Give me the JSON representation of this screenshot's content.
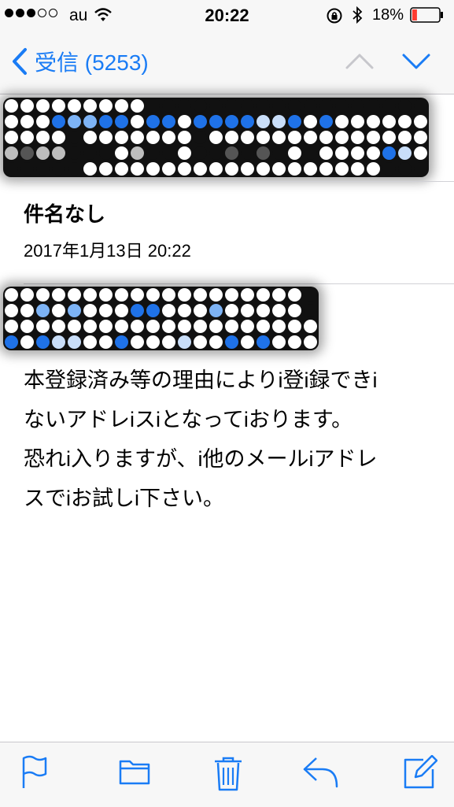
{
  "status_bar": {
    "carrier": "au",
    "time": "20:22",
    "battery_percent": "18%",
    "signal_bars_filled": 3,
    "signal_bars_total": 5,
    "battery_level": 0.18,
    "battery_color": "#ff3b30"
  },
  "nav": {
    "back_label": "受信 (5253)",
    "accent": "#1a7cf5"
  },
  "message": {
    "subject": "件名なし",
    "date": "2017年1月13日 20:22",
    "body_lines": [
      "本登録済み等の理由によりi登i録できi",
      "ないアドレiスiとなってiおります。",
      "恐れi入りますが、i他のメールiアドレ",
      "スでiお試しi下さい。"
    ]
  },
  "redactions": {
    "from": [
      "wwwwwwwwwkkkkkkkkkkkkkkkkkk",
      "wwwbllbbwbbwbbbbppbwbwwwwww",
      "wwwwkwwwwwwwkwwwwwwwwwwwwww",
      "lgllkkkwlkkwkkgkgkwkwwwwbpw",
      "kkkkkwwwwwwwwwwwwwwwwwwwkkk"
    ],
    "to": [
      "wwwwwwwwwwwwwwwwwwwk",
      "wwlwlwwwbbwwwlwwwwwk",
      "wwwwwwwwwwwwwwwwwwww",
      "bwbppwwbwwwpwwbwbwww"
    ]
  },
  "toolbar": {
    "icons": [
      "flag-icon",
      "folder-icon",
      "trash-icon",
      "reply-icon",
      "compose-icon"
    ]
  }
}
